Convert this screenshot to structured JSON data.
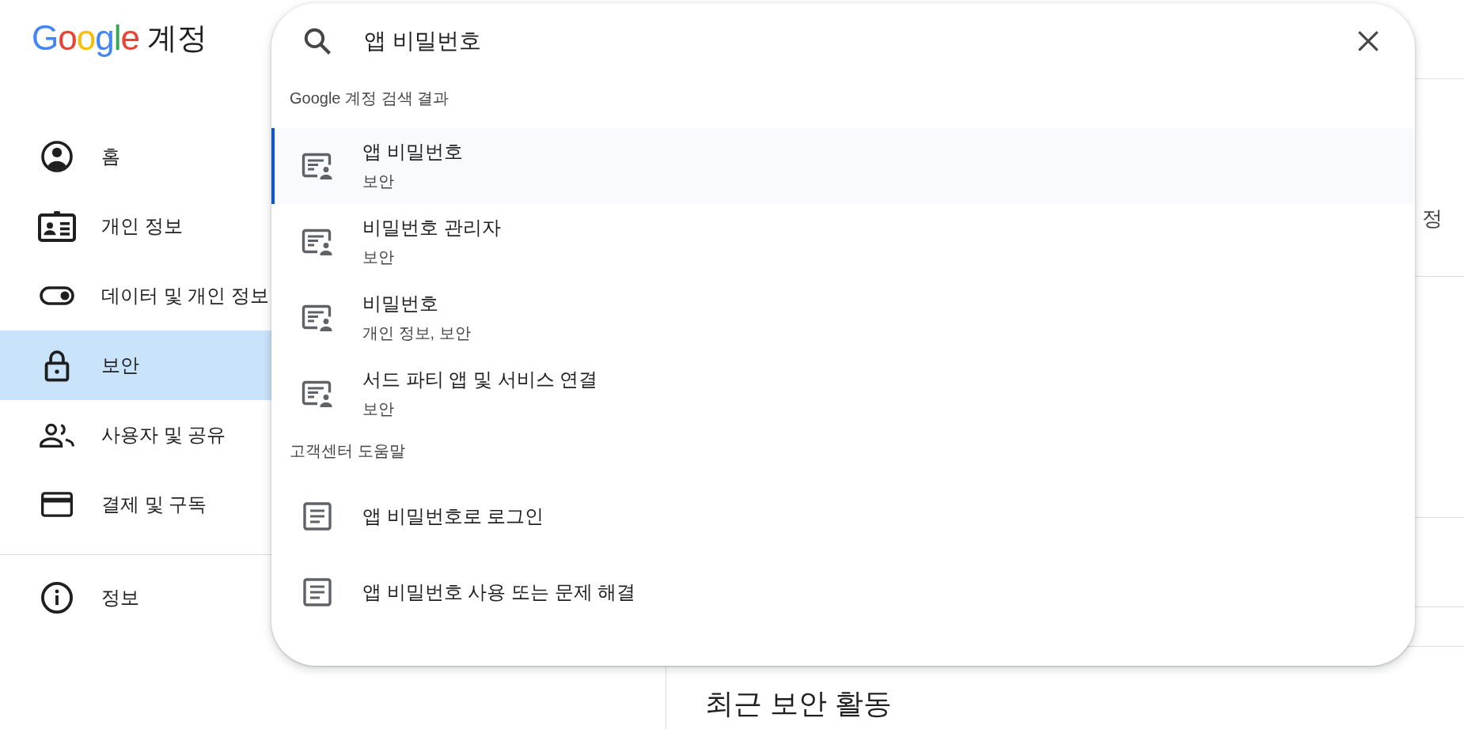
{
  "header": {
    "logo": "Google",
    "product_name": "계정"
  },
  "sidebar": {
    "items": [
      {
        "kind": "account",
        "label": "홈",
        "selected": false
      },
      {
        "kind": "id_card",
        "label": "개인 정보",
        "selected": false
      },
      {
        "kind": "toggle",
        "label": "데이터 및 개인 정보",
        "selected": false
      },
      {
        "kind": "lock",
        "label": "보안",
        "selected": true
      },
      {
        "kind": "people",
        "label": "사용자 및 공유",
        "selected": false
      },
      {
        "kind": "card",
        "label": "결제 및 구독",
        "selected": false
      }
    ],
    "footer_items": [
      {
        "kind": "info",
        "label": "정보",
        "selected": false
      }
    ]
  },
  "main": {
    "section_label": "정",
    "heading": "최근 보안 활동"
  },
  "search": {
    "value": "앱 비밀번호"
  },
  "results": [
    {
      "title": "Google 계정 검색 결과",
      "kind": "setting",
      "items": [
        {
          "title": "앱 비밀번호",
          "subtitle": "보안",
          "selected": true
        },
        {
          "title": "비밀번호 관리자",
          "subtitle": "보안",
          "selected": false
        },
        {
          "title": "비밀번호",
          "subtitle": "개인 정보, 보안",
          "selected": false
        },
        {
          "title": "서드 파티 앱 및 서비스 연결",
          "subtitle": "보안",
          "selected": false
        }
      ]
    },
    {
      "title": "고객센터 도움말",
      "kind": "article",
      "items": [
        {
          "title": "앱 비밀번호로 로그인",
          "selected": false
        },
        {
          "title": "앱 비밀번호 사용 또는 문제 해결",
          "selected": false
        }
      ]
    }
  ]
}
